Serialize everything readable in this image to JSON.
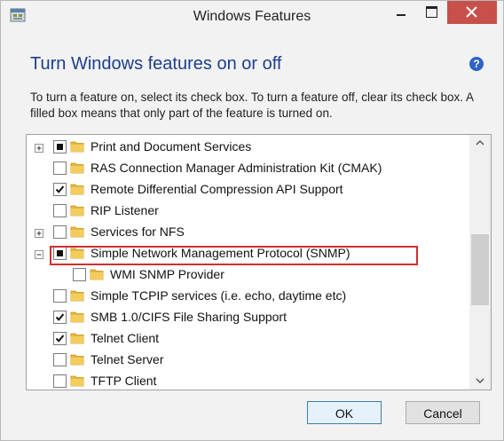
{
  "window": {
    "title": "Windows Features"
  },
  "heading": "Turn Windows features on or off",
  "description": "To turn a feature on, select its check box. To turn a feature off, clear its check box. A filled box means that only part of the feature is turned on.",
  "features": [
    {
      "label": "Print and Document Services",
      "state": "partial",
      "expander": "plus",
      "indent": 0
    },
    {
      "label": "RAS Connection Manager Administration Kit (CMAK)",
      "state": "unchecked",
      "expander": "none",
      "indent": 0
    },
    {
      "label": "Remote Differential Compression API Support",
      "state": "checked",
      "expander": "none",
      "indent": 0
    },
    {
      "label": "RIP Listener",
      "state": "unchecked",
      "expander": "none",
      "indent": 0
    },
    {
      "label": "Services for NFS",
      "state": "unchecked",
      "expander": "plus",
      "indent": 0
    },
    {
      "label": "Simple Network Management Protocol (SNMP)",
      "state": "partial",
      "expander": "minus",
      "indent": 0
    },
    {
      "label": "WMI SNMP Provider",
      "state": "unchecked",
      "expander": "none",
      "indent": 1
    },
    {
      "label": "Simple TCPIP services (i.e. echo, daytime etc)",
      "state": "unchecked",
      "expander": "none",
      "indent": 0
    },
    {
      "label": "SMB 1.0/CIFS File Sharing Support",
      "state": "checked",
      "expander": "none",
      "indent": 0
    },
    {
      "label": "Telnet Client",
      "state": "checked",
      "expander": "none",
      "indent": 0
    },
    {
      "label": "Telnet Server",
      "state": "unchecked",
      "expander": "none",
      "indent": 0
    },
    {
      "label": "TFTP Client",
      "state": "unchecked",
      "expander": "none",
      "indent": 0
    }
  ],
  "buttons": {
    "ok": "OK",
    "cancel": "Cancel"
  },
  "colors": {
    "heading": "#1c3e8e",
    "highlight_border": "#d02f2f",
    "close_button": "#c7504b",
    "folder": "#e8b73a"
  }
}
